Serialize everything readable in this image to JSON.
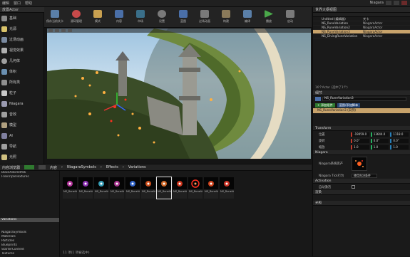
{
  "menubar": {
    "items": [
      "编辑",
      "窗口",
      "帮助"
    ],
    "title_text": "Niagara"
  },
  "left_panel": {
    "tab_label": "放置Actor",
    "items": [
      {
        "label": "基础",
        "icon": "cube-icon",
        "color": "#8a8a8a"
      },
      {
        "label": "光源",
        "icon": "light-icon",
        "color": "#d9c36a"
      },
      {
        "label": "过场动画",
        "icon": "camera-icon",
        "color": "#7a8aa0"
      },
      {
        "label": "视觉效果",
        "icon": "sparkle-icon",
        "color": "#b0b0b0"
      },
      {
        "label": "几何体",
        "icon": "sphere-icon",
        "color": "#a0a0a0"
      },
      {
        "label": "体积",
        "icon": "volume-icon",
        "color": "#6a8fb0"
      },
      {
        "label": "所有类",
        "icon": "list-icon",
        "color": "#909090"
      },
      {
        "label": "粒子",
        "icon": "particle-icon",
        "color": "#c8c8c8"
      },
      {
        "label": "Niagara",
        "icon": "niagara-icon",
        "color": "#9a9ab0"
      },
      {
        "label": "音效",
        "icon": "audio-icon",
        "color": "#a0a0a0"
      },
      {
        "label": "模型",
        "icon": "mesh-icon",
        "color": "#b0a080"
      },
      {
        "label": "AI",
        "icon": "ai-icon",
        "color": "#8080a0"
      },
      {
        "label": "导航",
        "icon": "nav-icon",
        "color": "#a0a0a0"
      },
      {
        "label": "光照",
        "icon": "lighting-icon",
        "color": "#d0c080"
      }
    ]
  },
  "toolbar": {
    "buttons": [
      {
        "label": "保存当前关卡",
        "icon": "save-icon",
        "color": "#5a7fa8"
      },
      {
        "label": "源码管理",
        "icon": "source-control-icon",
        "color": "#c84a4a"
      },
      {
        "label": "模式",
        "icon": "modes-icon",
        "color": "#c8a050"
      },
      {
        "label": "内容",
        "icon": "content-icon",
        "color": "#4a6fa8"
      },
      {
        "label": "市场",
        "icon": "marketplace-icon",
        "color": "#3a6f8a"
      },
      {
        "label": "设置",
        "icon": "settings-icon",
        "color": "#7a7a7a"
      },
      {
        "label": "蓝图",
        "icon": "blueprint-icon",
        "color": "#4a6fa8"
      },
      {
        "label": "过场动画",
        "icon": "cinematics-icon",
        "color": "#7a7a7a"
      },
      {
        "label": "构建",
        "icon": "build-icon",
        "color": "#8a7a5a"
      },
      {
        "label": "编译",
        "icon": "compile-icon",
        "color": "#5a7fa8"
      },
      {
        "label": "播放",
        "icon": "play-icon",
        "color": "#4aa84a"
      },
      {
        "label": "启动",
        "icon": "launch-icon",
        "color": "#7a7a7a"
      }
    ]
  },
  "outliner": {
    "header": "世界大纲视图",
    "rows": [
      {
        "name": "Untitled (编辑器)",
        "type": "关卡"
      },
      {
        "name": "NS_RuneVariation",
        "type": "NiagaraActor"
      },
      {
        "name": "NS_RuneVariation2",
        "type": "NiagaraActor"
      },
      {
        "name": "NS_RuneVariation3",
        "type": "NiagaraActor"
      },
      {
        "name": "NS_DivingRuneVariation",
        "type": "NiagaraActor"
      }
    ],
    "status": "16个Actor (选中了1个)"
  },
  "details": {
    "header": "细节",
    "name_field": "NS_RuneVariation3",
    "add_component": "+ 添加组件",
    "blueprint_btn": "蓝图/添加脚本",
    "component": "NS_RuneVariation3 (实例)",
    "transform": {
      "location": {
        "label": "位置",
        "x": "-19059.0",
        "y": "13644.0",
        "z": "1118.0"
      },
      "rotation": {
        "label": "旋转",
        "x": "0.0°",
        "y": "0.0°",
        "z": "0.0°"
      },
      "scale": {
        "label": "缩放",
        "x": "1.0",
        "y": "1.0",
        "z": "1.0"
      }
    },
    "niagara_section": "Niagara",
    "niagara_asset_label": "Niagara系统资产",
    "niagara_tick_label": "Niagara Tick行为",
    "niagara_tick_value": "使用先决条件",
    "sections": [
      "Activation",
      "渲染",
      "光照"
    ],
    "auto_activate": "自动激活"
  },
  "content_browser": {
    "tab": "内容浏览器",
    "path": [
      "内容",
      "NiagaraSymbols",
      "Effects",
      "Variations"
    ],
    "tree": [
      "BlackAdoredPak",
      "FreeTripleTextures",
      "",
      "",
      "",
      "",
      "",
      "",
      "",
      "",
      "",
      "Variations",
      "",
      "",
      "NiagaraSymbols",
      "Materials",
      "Particles",
      "Blueprints",
      "StarterContent",
      "Textures"
    ],
    "assets": [
      {
        "name": "NS_RuneVariation",
        "color": "#e040c0"
      },
      {
        "name": "NS_RuneVariation2",
        "color": "#b040e0"
      },
      {
        "name": "NS_RuneVariation3",
        "color": "#40c0e0"
      },
      {
        "name": "NS_RuneVariation4",
        "color": "#d040b0"
      },
      {
        "name": "NS_RuneVariation5",
        "color": "#4080ff"
      },
      {
        "name": "NS_RuneVariation6",
        "color": "#ff6020"
      },
      {
        "name": "NS_RuneVariation7",
        "color": "#ff8030"
      },
      {
        "name": "NS_RuneVariation8",
        "color": "#ff4020"
      },
      {
        "name": "NS_RuneVariation9",
        "color": "#ff3020"
      },
      {
        "name": "NS_RuneVariation10",
        "color": "#ff5020"
      },
      {
        "name": "NS_RuneVariation11",
        "color": "#ff4030"
      }
    ],
    "status": "11 项(1 项被选中)"
  }
}
